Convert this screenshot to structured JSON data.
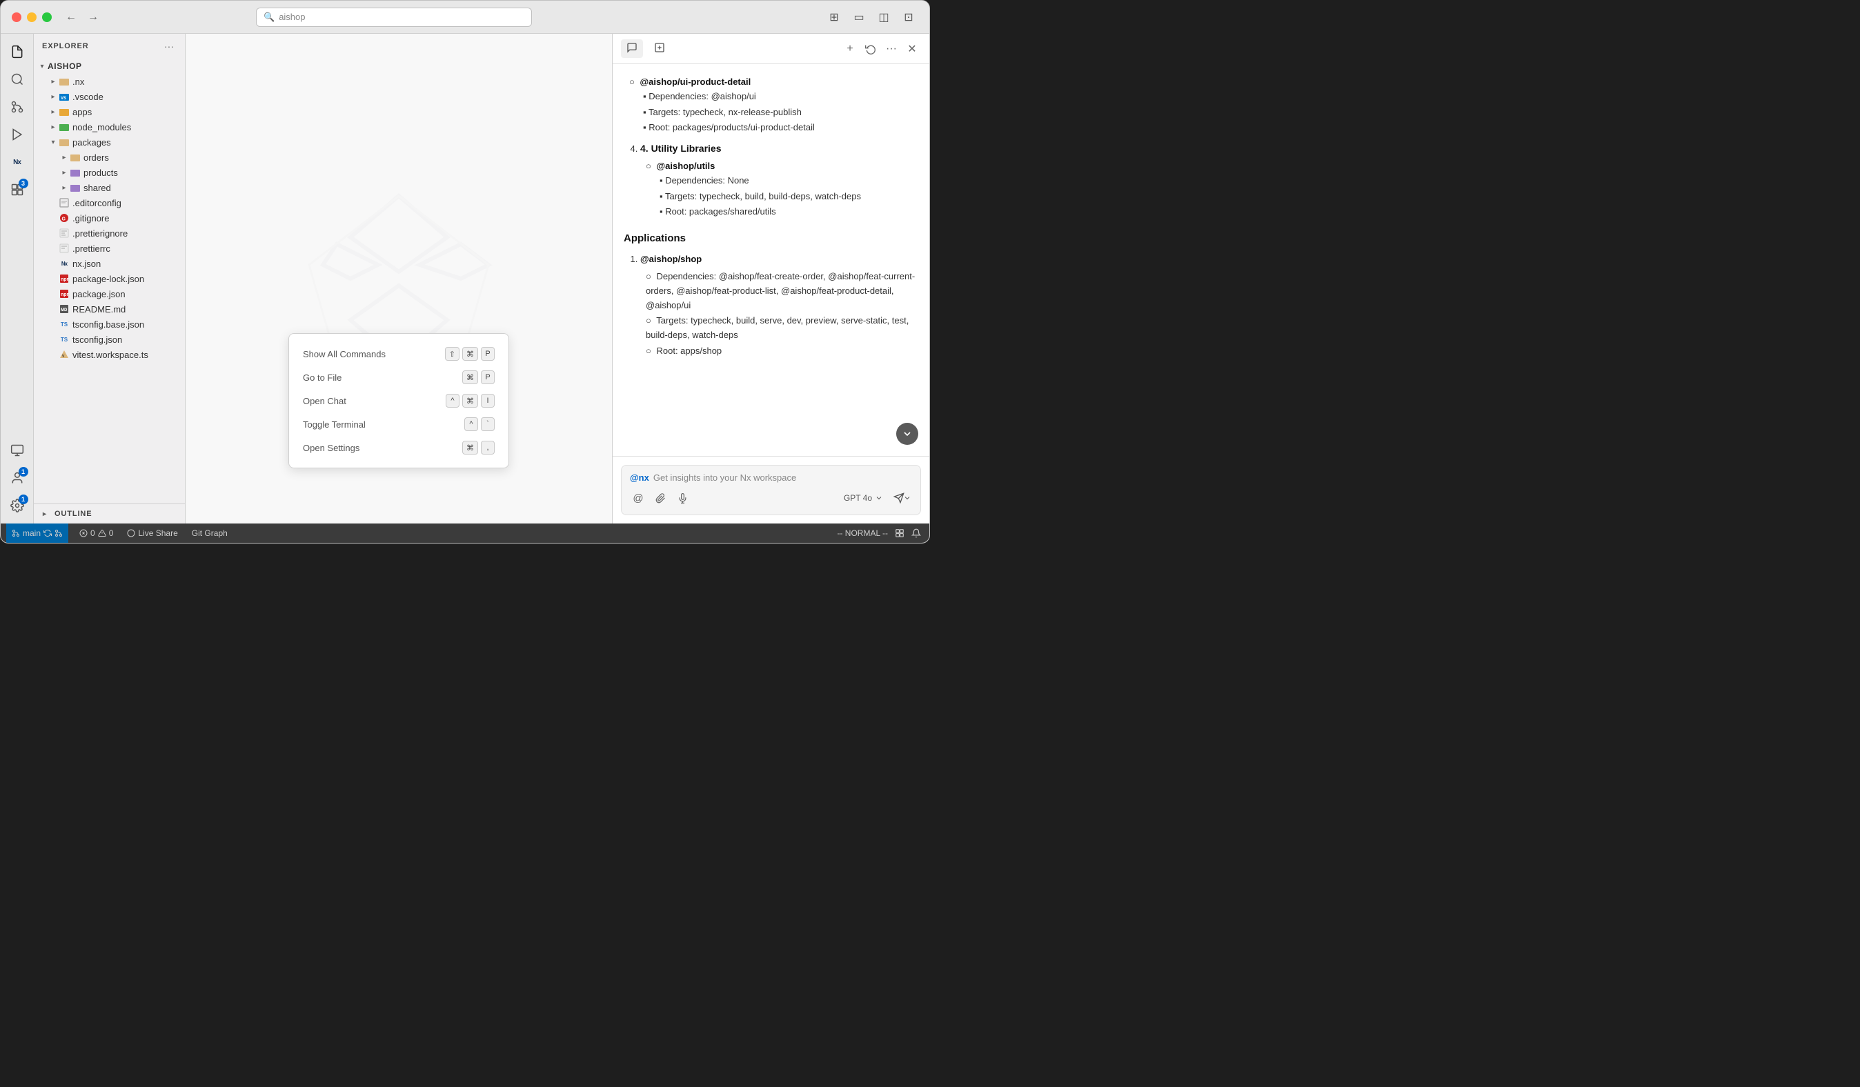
{
  "window": {
    "title": "aishop"
  },
  "titlebar": {
    "search_placeholder": "aishop",
    "back_label": "←",
    "forward_label": "→"
  },
  "activity_bar": {
    "items": [
      {
        "id": "explorer",
        "icon": "📄",
        "label": "Explorer",
        "active": true
      },
      {
        "id": "search",
        "icon": "🔍",
        "label": "Search",
        "active": false
      },
      {
        "id": "source-control",
        "icon": "⑂",
        "label": "Source Control",
        "active": false
      },
      {
        "id": "run",
        "icon": "▶",
        "label": "Run and Debug",
        "active": false
      },
      {
        "id": "nx",
        "icon": "Nx",
        "label": "Nx",
        "active": false
      },
      {
        "id": "extensions",
        "icon": "⊞",
        "label": "Extensions",
        "badge": "3"
      },
      {
        "id": "remote",
        "icon": "⊡",
        "label": "Remote Explorer",
        "active": false
      }
    ],
    "bottom_items": [
      {
        "id": "account",
        "icon": "👤",
        "label": "Account",
        "badge": "1"
      },
      {
        "id": "settings",
        "icon": "⚙",
        "label": "Settings",
        "badge": "1"
      }
    ]
  },
  "sidebar": {
    "header": "Explorer",
    "root": "AISHOP",
    "tree": [
      {
        "id": "nx",
        "label": ".nx",
        "indent": 1,
        "icon": "nx",
        "type": "folder",
        "state": "closed"
      },
      {
        "id": "vscode",
        "label": ".vscode",
        "indent": 1,
        "icon": "vscode",
        "type": "folder",
        "state": "closed"
      },
      {
        "id": "apps",
        "label": "apps",
        "indent": 1,
        "icon": "apps",
        "type": "folder",
        "state": "closed"
      },
      {
        "id": "node_modules",
        "label": "node_modules",
        "indent": 1,
        "icon": "node",
        "type": "folder",
        "state": "closed"
      },
      {
        "id": "packages",
        "label": "packages",
        "indent": 1,
        "icon": "packages",
        "type": "folder",
        "state": "open"
      },
      {
        "id": "orders",
        "label": "orders",
        "indent": 2,
        "icon": "orders",
        "type": "folder",
        "state": "closed"
      },
      {
        "id": "products",
        "label": "products",
        "indent": 2,
        "icon": "products",
        "type": "folder",
        "state": "closed"
      },
      {
        "id": "shared",
        "label": "shared",
        "indent": 2,
        "icon": "shared",
        "type": "folder",
        "state": "closed"
      },
      {
        "id": "editorconfig",
        "label": ".editorconfig",
        "indent": 1,
        "icon": "editorconfig",
        "type": "file"
      },
      {
        "id": "gitignore",
        "label": ".gitignore",
        "indent": 1,
        "icon": "gitignore",
        "type": "file"
      },
      {
        "id": "prettierignore",
        "label": ".prettierignore",
        "indent": 1,
        "icon": "prettierignore",
        "type": "file"
      },
      {
        "id": "prettierrc",
        "label": ".prettierrc",
        "indent": 1,
        "icon": "prettierrc",
        "type": "file"
      },
      {
        "id": "nx_json",
        "label": "nx.json",
        "indent": 1,
        "icon": "nx_json",
        "type": "file"
      },
      {
        "id": "package_lock",
        "label": "package-lock.json",
        "indent": 1,
        "icon": "package_lock",
        "type": "file"
      },
      {
        "id": "package_json",
        "label": "package.json",
        "indent": 1,
        "icon": "package_json",
        "type": "file"
      },
      {
        "id": "readme",
        "label": "README.md",
        "indent": 1,
        "icon": "readme",
        "type": "file"
      },
      {
        "id": "tsconfig_base",
        "label": "tsconfig.base.json",
        "indent": 1,
        "icon": "tsconfig",
        "type": "file"
      },
      {
        "id": "tsconfig",
        "label": "tsconfig.json",
        "indent": 1,
        "icon": "tsconfig",
        "type": "file"
      },
      {
        "id": "vitest",
        "label": "vitest.workspace.ts",
        "indent": 1,
        "icon": "vitest",
        "type": "file"
      }
    ],
    "outline_label": "OUTLINE"
  },
  "editor": {
    "watermark_visible": true
  },
  "command_palette": {
    "items": [
      {
        "label": "Show All Commands",
        "shortcut": [
          "⇧",
          "⌘",
          "P"
        ]
      },
      {
        "label": "Go to File",
        "shortcut": [
          "⌘",
          "P"
        ]
      },
      {
        "label": "Open Chat",
        "shortcut": [
          "^",
          "⌘",
          "I"
        ]
      },
      {
        "label": "Toggle Terminal",
        "shortcut": [
          "^",
          "`"
        ]
      },
      {
        "label": "Open Settings",
        "shortcut": [
          "⌘",
          ","
        ]
      }
    ]
  },
  "chat_panel": {
    "tabs": [
      {
        "id": "chat",
        "icon": "💬",
        "label": "Chat",
        "active": true
      },
      {
        "id": "new",
        "icon": "+",
        "label": "New"
      }
    ],
    "actions": {
      "add": "+",
      "history": "⟳",
      "more": "…",
      "close": "✕"
    },
    "content": {
      "ui_product_detail": {
        "name": "@aishop/ui-product-detail",
        "dependencies": "Dependencies: @aishop/ui",
        "targets": "Targets: typecheck, nx-release-publish",
        "root": "Root: packages/products/ui-product-detail"
      },
      "section_utility": {
        "title": "4. Utility Libraries",
        "utils": {
          "name": "@aishop/utils",
          "dependencies": "Dependencies: None",
          "targets": "Targets: typecheck, build, build-deps, watch-deps",
          "root": "Root: packages/shared/utils"
        }
      },
      "section_applications": {
        "title": "Applications",
        "shop": {
          "number": "1.",
          "name": "@aishop/shop",
          "dependencies": "Dependencies: @aishop/feat-create-order, @aishop/feat-current-orders, @aishop/feat-product-list, @aishop/feat-product-detail, @aishop/ui",
          "targets": "Targets: typecheck, build, serve, dev, preview, serve-static, test, build-deps, watch-deps",
          "root": "Root: apps/shop"
        }
      }
    },
    "input": {
      "at_mention": "@nx",
      "placeholder": "Get insights into your Nx workspace",
      "model": "GPT 4o"
    }
  },
  "status_bar": {
    "branch_icon": "⑂",
    "branch": "main",
    "sync_icon": "↻",
    "fork_icon": "⑂",
    "errors": "0",
    "warnings": "0",
    "error_icon": "✗",
    "warning_icon": "△",
    "live_share": "Live Share",
    "git_graph": "Git Graph",
    "mode": "-- NORMAL --",
    "live_share_icon": "◎",
    "extensions_icon": "⊞",
    "bell_icon": "🔔"
  }
}
